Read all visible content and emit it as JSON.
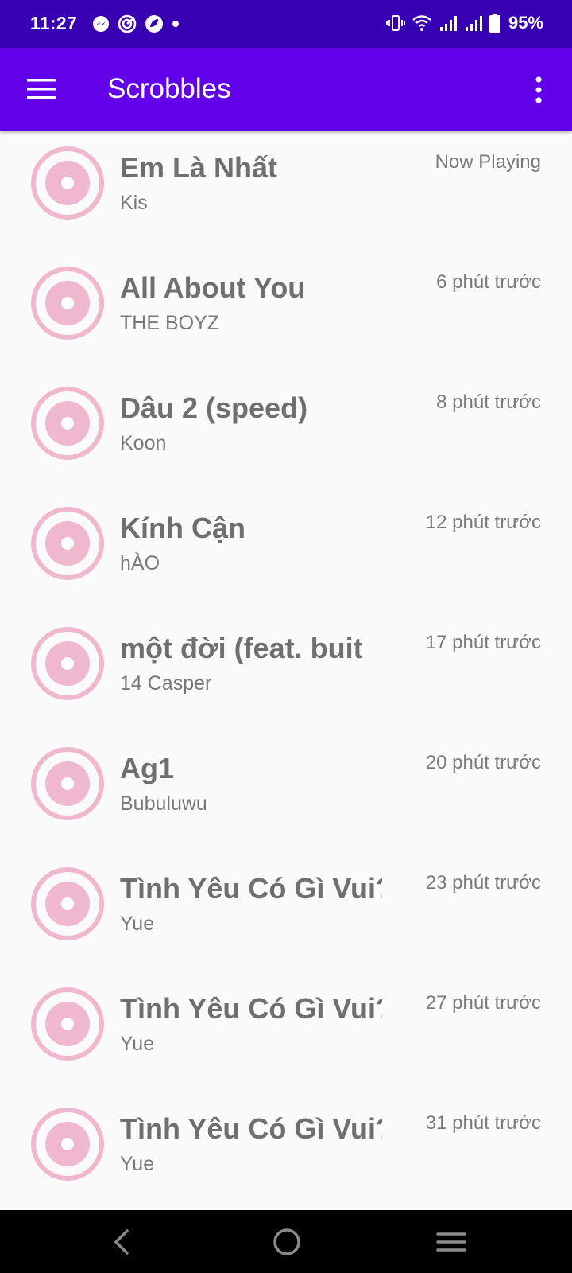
{
  "status_bar": {
    "time": "11:27",
    "battery": "95%",
    "left_icons": [
      "messenger-icon",
      "target-app-icon",
      "leaf-icon",
      "dot-icon"
    ],
    "right_icons": [
      "vibrate-icon",
      "wifi-icon",
      "signal-icon",
      "signal-icon",
      "battery-icon"
    ]
  },
  "app_bar": {
    "title": "Scrobbles",
    "menu_icon": "hamburger-menu-icon",
    "overflow_icon": "more-vert-icon",
    "color": "#6200ea"
  },
  "colors": {
    "status_bar": "#3800b3",
    "app_bar": "#6200ea",
    "disc": "#f0b8ce",
    "background": "#fafafa"
  },
  "scrobbles": [
    {
      "track": "Em Là Nhất",
      "artist": "Kis",
      "time": "Now Playing"
    },
    {
      "track": "All About You",
      "artist": "THE BOYZ",
      "time": "6 phút trước"
    },
    {
      "track": "Dâu 2 (speed)",
      "artist": "Koon",
      "time": "8 phút trước"
    },
    {
      "track": "Kính Cận",
      "artist": "hÀO",
      "time": "12 phút trước"
    },
    {
      "track": "một đời (feat. buit",
      "artist": "14 Casper",
      "time": "17 phút trước"
    },
    {
      "track": "Ag1",
      "artist": "Bubuluwu",
      "time": "20 phút trước"
    },
    {
      "track": "Tình Yêu Có Gì Vui?",
      "artist": "Yue",
      "time": "23 phút trước"
    },
    {
      "track": "Tình Yêu Có Gì Vui?",
      "artist": "Yue",
      "time": "27 phút trước"
    },
    {
      "track": "Tình Yêu Có Gì Vui?",
      "artist": "Yue",
      "time": "31 phút trước"
    }
  ],
  "nav_bar": {
    "buttons": [
      "back-icon",
      "home-icon",
      "recents-icon"
    ]
  }
}
